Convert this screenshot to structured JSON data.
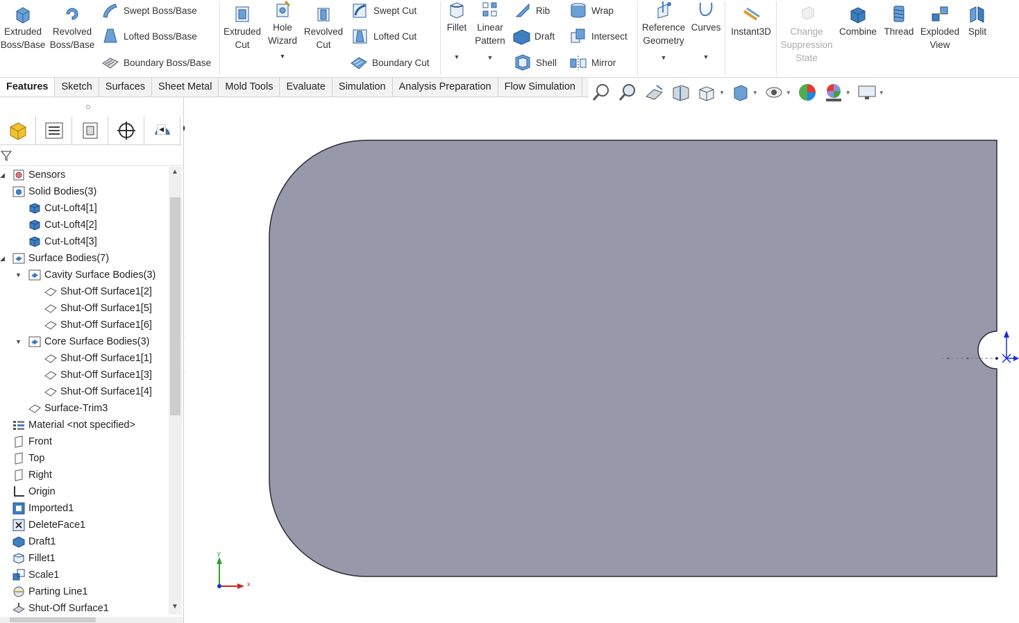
{
  "ribbon": {
    "extruded_boss": "Extruded\nBoss/Base",
    "revolved_boss": "Revolved\nBoss/Base",
    "swept_boss": "Swept Boss/Base",
    "lofted_boss": "Lofted Boss/Base",
    "boundary_boss": "Boundary Boss/Base",
    "extruded_cut": "Extruded\nCut",
    "hole_wizard": "Hole\nWizard",
    "revolved_cut": "Revolved\nCut",
    "swept_cut": "Swept Cut",
    "lofted_cut": "Lofted Cut",
    "boundary_cut": "Boundary Cut",
    "fillet": "Fillet",
    "linear_pattern": "Linear\nPattern",
    "rib": "Rib",
    "draft": "Draft",
    "shell": "Shell",
    "wrap": "Wrap",
    "intersect": "Intersect",
    "mirror": "Mirror",
    "reference_geometry": "Reference\nGeometry",
    "curves": "Curves",
    "instant3d": "Instant3D",
    "change_suppression": "Change\nSuppression\nState",
    "combine": "Combine",
    "thread": "Thread",
    "exploded_view": "Exploded\nView",
    "split": "Split"
  },
  "tabs": [
    "Features",
    "Sketch",
    "Surfaces",
    "Sheet Metal",
    "Mold Tools",
    "Evaluate",
    "Simulation",
    "Analysis Preparation",
    "Flow Simulation"
  ],
  "tree": {
    "items": [
      {
        "label": "Sensors"
      },
      {
        "label": "Solid Bodies(3)"
      },
      {
        "label": "Cut-Loft4[1]"
      },
      {
        "label": "Cut-Loft4[2]"
      },
      {
        "label": "Cut-Loft4[3]"
      },
      {
        "label": "Surface Bodies(7)"
      },
      {
        "label": "Cavity Surface Bodies(3)"
      },
      {
        "label": "Shut-Off Surface1[2]"
      },
      {
        "label": "Shut-Off Surface1[5]"
      },
      {
        "label": "Shut-Off Surface1[6]"
      },
      {
        "label": "Core Surface Bodies(3)"
      },
      {
        "label": "Shut-Off Surface1[1]"
      },
      {
        "label": "Shut-Off Surface1[3]"
      },
      {
        "label": "Shut-Off Surface1[4]"
      },
      {
        "label": "Surface-Trim3"
      },
      {
        "label": "Material <not specified>"
      },
      {
        "label": "Front"
      },
      {
        "label": "Top"
      },
      {
        "label": "Right"
      },
      {
        "label": "Origin"
      },
      {
        "label": "Imported1"
      },
      {
        "label": "DeleteFace1"
      },
      {
        "label": "Draft1"
      },
      {
        "label": "Fillet1"
      },
      {
        "label": "Scale1"
      },
      {
        "label": "Parting Line1"
      },
      {
        "label": "Shut-Off Surface1"
      }
    ]
  },
  "triad": {
    "x": "x",
    "y": "y"
  },
  "colors": {
    "part_face": "#9799ab",
    "edge": "#2a2a30",
    "icon_blue": "#3d7fc1"
  }
}
